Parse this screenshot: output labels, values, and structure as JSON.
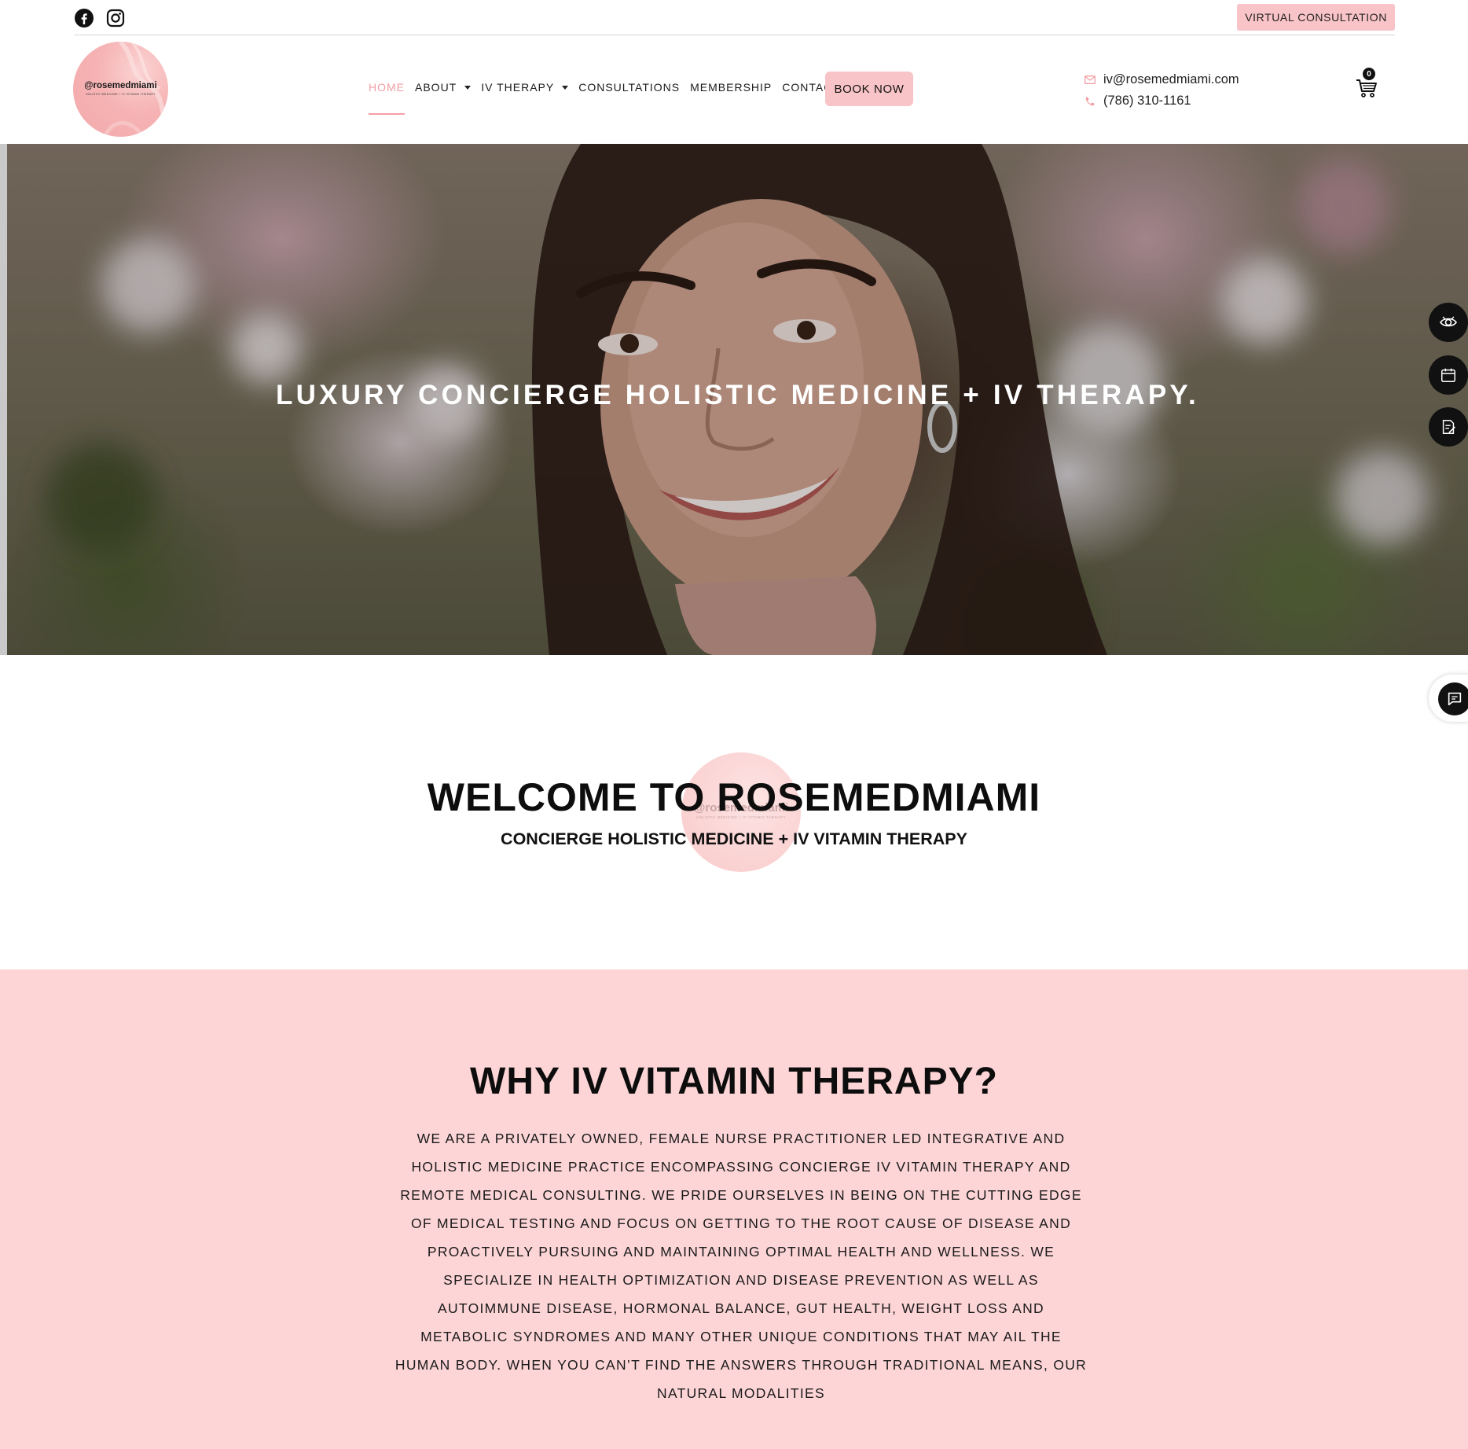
{
  "topbar": {
    "social": [
      "facebook-icon",
      "instagram-icon"
    ],
    "virtual_consultation": "VIRTUAL CONSULTATION"
  },
  "logo": {
    "handle": "@rosemedmiami",
    "tagline": "HOLISTIC MEDICINE + IV VITAMIN THERAPY"
  },
  "nav": {
    "items": [
      {
        "label": "HOME",
        "active": true,
        "dropdown": false
      },
      {
        "label": "ABOUT",
        "active": false,
        "dropdown": true
      },
      {
        "label": "IV THERAPY",
        "active": false,
        "dropdown": true
      },
      {
        "label": "CONSULTATIONS",
        "active": false,
        "dropdown": false
      },
      {
        "label": "MEMBERSHIP",
        "active": false,
        "dropdown": false
      },
      {
        "label": "CONTACT",
        "active": false,
        "dropdown": false
      }
    ],
    "book_now": "BOOK NOW"
  },
  "contact": {
    "email": "iv@rosemedmiami.com",
    "phone": "(786) 310-1161"
  },
  "cart": {
    "count": "0"
  },
  "hero": {
    "title": "LUXURY CONCIERGE HOLISTIC MEDICINE + IV THERAPY."
  },
  "side_widgets": [
    "accessibility-eye-icon",
    "calendar-icon",
    "signature-form-icon",
    "chat-icon"
  ],
  "welcome": {
    "title": "WELCOME TO ROSEMEDMIAMI",
    "subtitle": "CONCIERGE HOLISTIC MEDICINE + IV VITAMIN THERAPY",
    "badge_handle": "@rosemedmiami",
    "badge_tagline": "HOLISTIC MEDICINE + IV VITAMIN THERAPY"
  },
  "why": {
    "title": "WHY IV VITAMIN THERAPY?",
    "body": "WE ARE A PRIVATELY OWNED, FEMALE NURSE PRACTITIONER LED INTEGRATIVE AND HOLISTIC MEDICINE PRACTICE ENCOMPASSING CONCIERGE IV VITAMIN THERAPY AND REMOTE MEDICAL CONSULTING. WE PRIDE OURSELVES IN BEING ON THE CUTTING EDGE OF MEDICAL TESTING AND FOCUS ON GETTING TO THE ROOT CAUSE OF DISEASE AND PROACTIVELY PURSUING AND MAINTAINING OPTIMAL HEALTH AND WELLNESS. WE SPECIALIZE IN HEALTH OPTIMIZATION AND DISEASE PREVENTION AS WELL AS AUTOIMMUNE DISEASE, HORMONAL BALANCE, GUT HEALTH, WEIGHT LOSS AND METABOLIC SYNDROMES AND MANY OTHER UNIQUE CONDITIONS THAT MAY AIL THE HUMAN BODY. WHEN YOU CAN’T FIND THE ANSWERS THROUGH TRADITIONAL MEANS, OUR NATURAL MODALITIES"
  },
  "colors": {
    "accent_pink": "#f9c4c7",
    "active_nav": "#f39ea3",
    "section_pink": "#fdd5d7"
  }
}
